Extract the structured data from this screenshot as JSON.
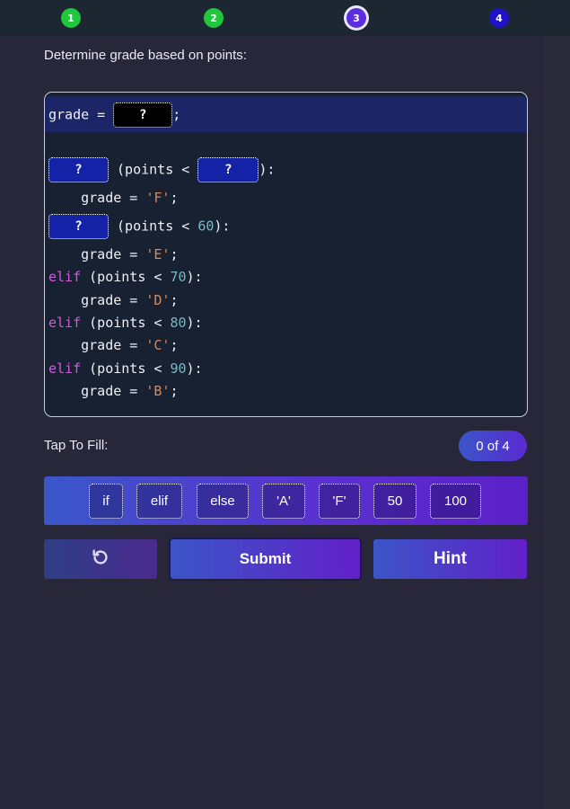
{
  "steps": [
    {
      "label": "1",
      "state": "done"
    },
    {
      "label": "2",
      "state": "done"
    },
    {
      "label": "3",
      "state": "current"
    },
    {
      "label": "4",
      "state": "todo"
    }
  ],
  "prompt": "Determine grade based on points:",
  "code": {
    "line1_prefix": "grade = ",
    "line1_suffix": ";",
    "slot_placeholder": "?",
    "line2_mid": " (points < ",
    "line2_end": "):",
    "line3_a": "    grade = ",
    "line3_str": "'F'",
    "line3_end": ";",
    "line4_mid": " (points < ",
    "line4_num": "60",
    "line4_end": "):",
    "line5_a": "    grade = ",
    "line5_str": "'E'",
    "line5_end": ";",
    "line6_kw": "elif",
    "line6_mid": " (points < ",
    "line6_num": "70",
    "line6_end": "):",
    "line7_a": "    grade = ",
    "line7_str": "'D'",
    "line7_end": ";",
    "line8_kw": "elif",
    "line8_mid": " (points < ",
    "line8_num": "80",
    "line8_end": "):",
    "line9_a": "    grade = ",
    "line9_str": "'C'",
    "line9_end": ";",
    "line10_kw": "elif",
    "line10_mid": " (points < ",
    "line10_num": "90",
    "line10_end": "):",
    "line11_a": "    grade = ",
    "line11_str": "'B'",
    "line11_end": ";"
  },
  "fill": {
    "label": "Tap To Fill:",
    "counter": "0 of 4"
  },
  "chips": [
    "if",
    "elif",
    "else",
    "'A'",
    "'F'",
    "50",
    "100"
  ],
  "buttons": {
    "undo_icon": "undo-icon",
    "submit": "Submit",
    "hint": "Hint"
  },
  "colors": {
    "step_done": "#1fc63e",
    "step_current": "#5b2ee0",
    "step_todo": "#1f12c8",
    "keyword": "#d05bd8",
    "number": "#76b9c4",
    "string": "#d88959"
  }
}
